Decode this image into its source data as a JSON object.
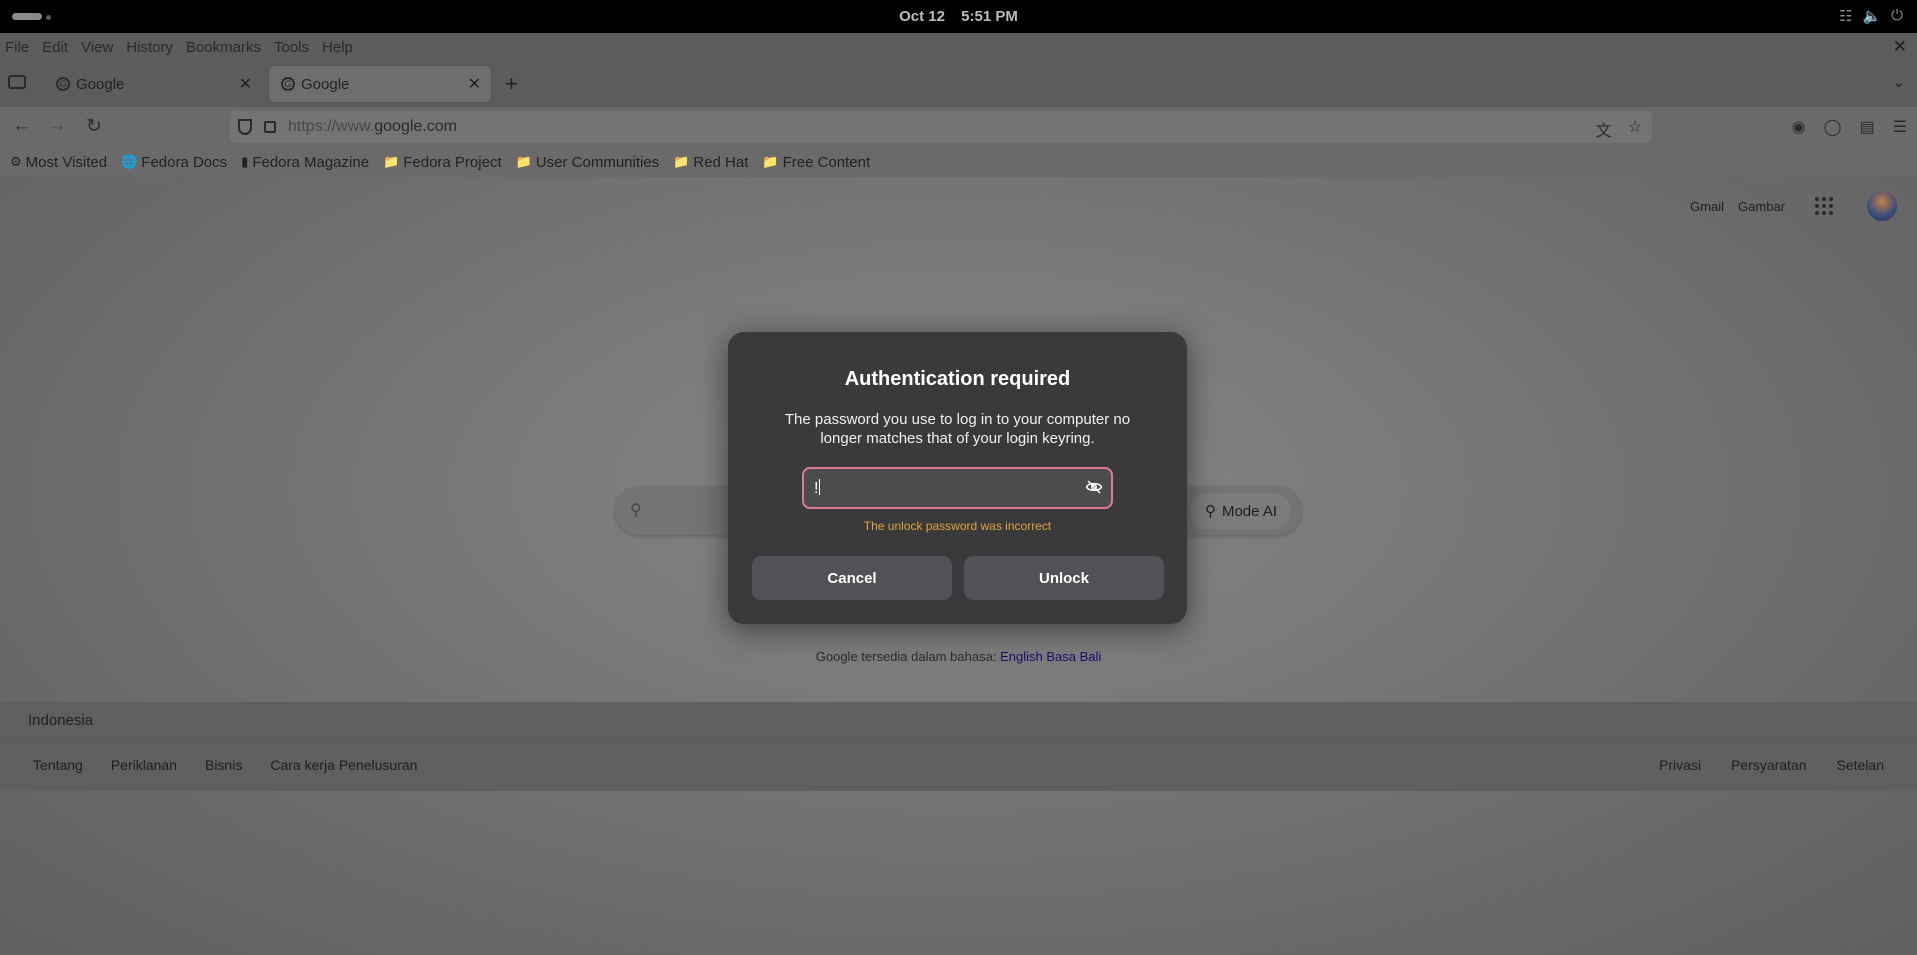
{
  "system": {
    "date": "Oct 12",
    "time": "5:51 PM",
    "tray_icons": [
      "network-icon",
      "volume-icon",
      "power-icon"
    ]
  },
  "browser": {
    "menu": [
      "File",
      "Edit",
      "View",
      "History",
      "Bookmarks",
      "Tools",
      "Help"
    ],
    "tabs": [
      {
        "title": "Google",
        "active": false
      },
      {
        "title": "Google",
        "active": true
      }
    ],
    "url_prefix": "https://www.",
    "url_domain": "google.com",
    "bookmarks": [
      {
        "label": "Most Visited",
        "icon": "gear-icon"
      },
      {
        "label": "Fedora Docs",
        "icon": "globe-icon"
      },
      {
        "label": "Fedora Magazine",
        "icon": "bookmark-icon"
      },
      {
        "label": "Fedora Project",
        "icon": "folder-icon"
      },
      {
        "label": "User Communities",
        "icon": "folder-icon"
      },
      {
        "label": "Red Hat",
        "icon": "folder-icon"
      },
      {
        "label": "Free Content",
        "icon": "folder-icon"
      }
    ]
  },
  "page": {
    "header_links": [
      "Gmail",
      "Gambar"
    ],
    "mode_ai_label": "Mode AI",
    "lang_prefix": "Google tersedia dalam bahasa:",
    "lang_links": [
      "English",
      "Basa Bali"
    ],
    "country": "Indonesia",
    "footer_left": [
      "Tentang",
      "Periklanan",
      "Bisnis",
      "Cara kerja Penelusuran"
    ],
    "footer_right": [
      "Privasi",
      "Persyaratan",
      "Setelan"
    ]
  },
  "dialog": {
    "title": "Authentication required",
    "message": "The password you use to log in to your computer no longer matches that of your login keyring.",
    "password_value": "!",
    "error": "The unlock password was incorrect",
    "cancel_label": "Cancel",
    "unlock_label": "Unlock",
    "field_border_color": "#e07a8c",
    "error_color": "#e2a23b"
  }
}
